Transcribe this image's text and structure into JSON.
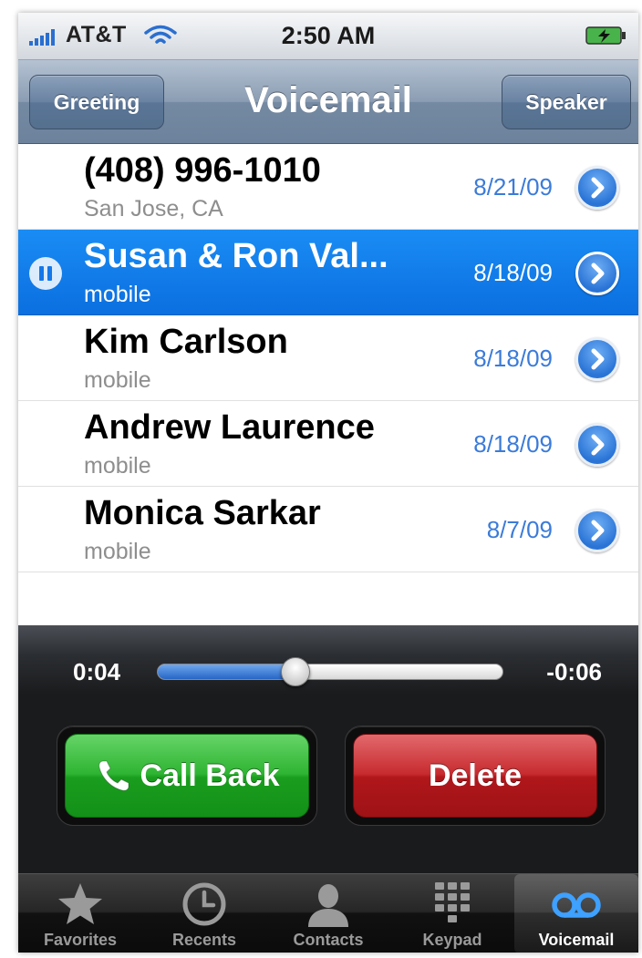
{
  "status_bar": {
    "carrier": "AT&T",
    "time": "2:50 AM"
  },
  "nav_bar": {
    "title": "Voicemail",
    "left_button": "Greeting",
    "right_button": "Speaker"
  },
  "voicemails": [
    {
      "name": "(408) 996-1010",
      "subtitle": "San Jose, CA",
      "date": "8/21/09",
      "selected": false
    },
    {
      "name": "Susan & Ron Val...",
      "subtitle": "mobile",
      "date": "8/18/09",
      "selected": true
    },
    {
      "name": "Kim Carlson",
      "subtitle": "mobile",
      "date": "8/18/09",
      "selected": false
    },
    {
      "name": "Andrew Laurence",
      "subtitle": "mobile",
      "date": "8/18/09",
      "selected": false
    },
    {
      "name": "Monica Sarkar",
      "subtitle": "mobile",
      "date": "8/7/09",
      "selected": false
    }
  ],
  "playback": {
    "elapsed": "0:04",
    "remaining": "-0:06",
    "progress": 0.4
  },
  "actions": {
    "call_back": "Call Back",
    "delete": "Delete"
  },
  "tab_bar": {
    "tabs": [
      {
        "label": "Favorites",
        "icon": "star-icon",
        "active": false
      },
      {
        "label": "Recents",
        "icon": "clock-icon",
        "active": false
      },
      {
        "label": "Contacts",
        "icon": "person-icon",
        "active": false
      },
      {
        "label": "Keypad",
        "icon": "keypad-icon",
        "active": false
      },
      {
        "label": "Voicemail",
        "icon": "voicemail-icon",
        "active": true
      }
    ]
  },
  "colors": {
    "selection_blue": "#0b6fe0",
    "date_blue": "#3b7bd9",
    "call_back_green": "#2eb432",
    "delete_red": "#c72b2f"
  }
}
